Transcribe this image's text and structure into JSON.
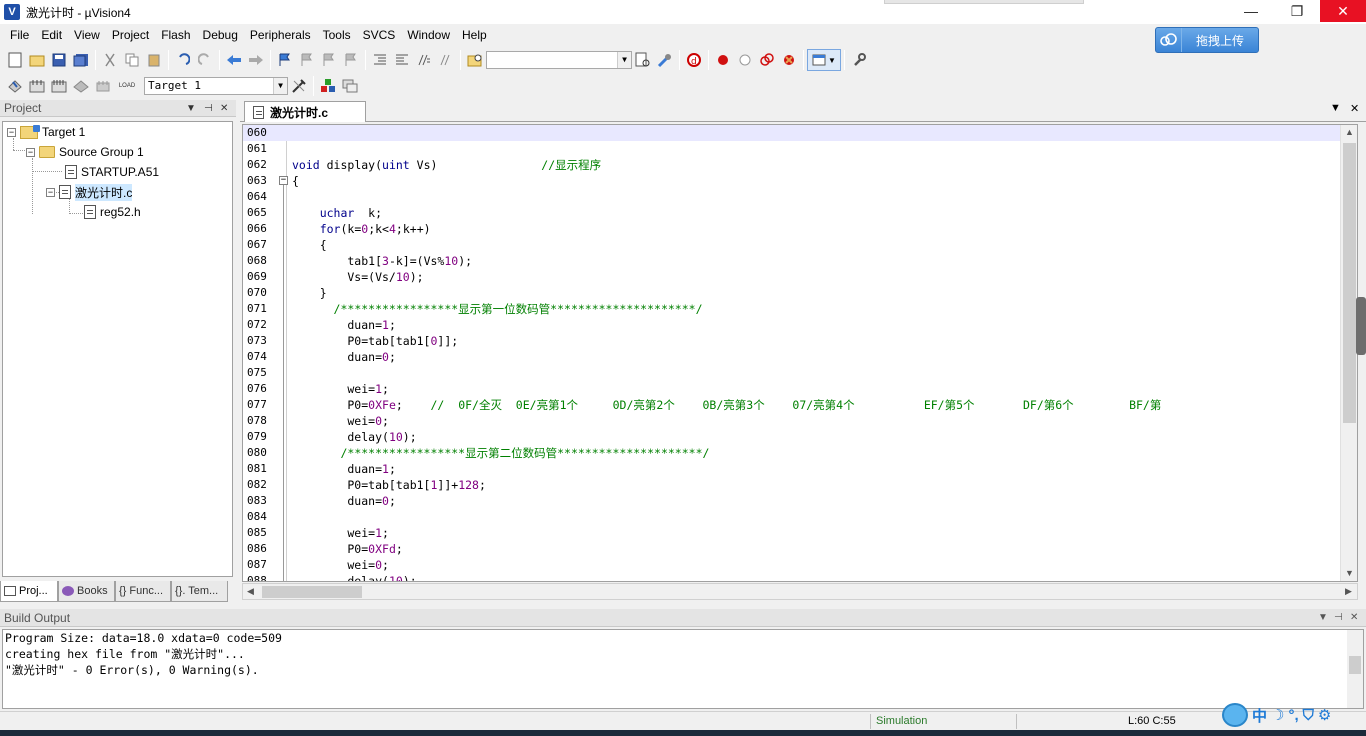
{
  "window": {
    "title": "激光计时 - µVision4",
    "min_glyph": "—",
    "max_glyph": "❐",
    "close_glyph": "✕"
  },
  "menu": [
    "File",
    "Edit",
    "View",
    "Project",
    "Flash",
    "Debug",
    "Peripherals",
    "Tools",
    "SVCS",
    "Window",
    "Help"
  ],
  "upload_button": {
    "label": "拖拽上传"
  },
  "toolbar2": {
    "load_label": "LOAD",
    "target_select": "Target 1"
  },
  "project_panel": {
    "title": "Project",
    "tree": {
      "target": "Target 1",
      "group": "Source Group 1",
      "files": [
        "STARTUP.A51",
        "激光计时.c"
      ],
      "include": "reg52.h"
    },
    "tabs": [
      "Proj...",
      "Books",
      "{} Func...",
      "{}. Tem..."
    ]
  },
  "editor": {
    "tab_label": "激光计时.c",
    "lines": [
      {
        "n": "060",
        "t": ""
      },
      {
        "n": "061",
        "t": ""
      },
      {
        "n": "062",
        "t": "void display(uint Vs)",
        "c": "               //显示程序"
      },
      {
        "n": "063",
        "t": "{"
      },
      {
        "n": "064",
        "t": ""
      },
      {
        "n": "065",
        "t": "    uchar  k;"
      },
      {
        "n": "066",
        "t": "    for(k=0;k<4;k++)"
      },
      {
        "n": "067",
        "t": "    {"
      },
      {
        "n": "068",
        "t": "        tab1[3-k]=(Vs%10);"
      },
      {
        "n": "069",
        "t": "        Vs=(Vs/10);"
      },
      {
        "n": "070",
        "t": "    }"
      },
      {
        "n": "071",
        "t": "      ",
        "c": "/*****************显示第一位数码管*********************/"
      },
      {
        "n": "072",
        "t": "        duan=1;"
      },
      {
        "n": "073",
        "t": "        P0=tab[tab1[0]];"
      },
      {
        "n": "074",
        "t": "        duan=0;"
      },
      {
        "n": "075",
        "t": ""
      },
      {
        "n": "076",
        "t": "        wei=1;"
      },
      {
        "n": "077",
        "t": "        P0=0XFe;    ",
        "c": "//  0F/全灭  0E/亮第1个     0D/亮第2个    0B/亮第3个    07/亮第4个          EF/第5个       DF/第6个        BF/第"
      },
      {
        "n": "078",
        "t": "        wei=0;"
      },
      {
        "n": "079",
        "t": "        delay(10);"
      },
      {
        "n": "080",
        "t": "       ",
        "c": "/*****************显示第二位数码管*********************/"
      },
      {
        "n": "081",
        "t": "        duan=1;"
      },
      {
        "n": "082",
        "t": "        P0=tab[tab1[1]]+128;"
      },
      {
        "n": "083",
        "t": "        duan=0;"
      },
      {
        "n": "084",
        "t": ""
      },
      {
        "n": "085",
        "t": "        wei=1;"
      },
      {
        "n": "086",
        "t": "        P0=0XFd;"
      },
      {
        "n": "087",
        "t": "        wei=0;"
      },
      {
        "n": "088",
        "t": "        delay(10);"
      }
    ]
  },
  "build_output": {
    "title": "Build Output",
    "lines": [
      "Program Size: data=18.0 xdata=0 code=509",
      "creating hex file from \"激光计时\"...",
      "\"激光计时\" - 0 Error(s), 0 Warning(s)."
    ]
  },
  "statusbar": {
    "mode": "Simulation",
    "position": "L:60 C:55"
  },
  "ime": {
    "lang": "中",
    "moon": "☽",
    "dots": "°,",
    "shirt": "⛉",
    "gear": "⚙"
  },
  "colors": {
    "keyword": "#00008b",
    "comment": "#008000",
    "number": "#800080",
    "current_line": "#e8e8ff",
    "close_red": "#e81123"
  }
}
